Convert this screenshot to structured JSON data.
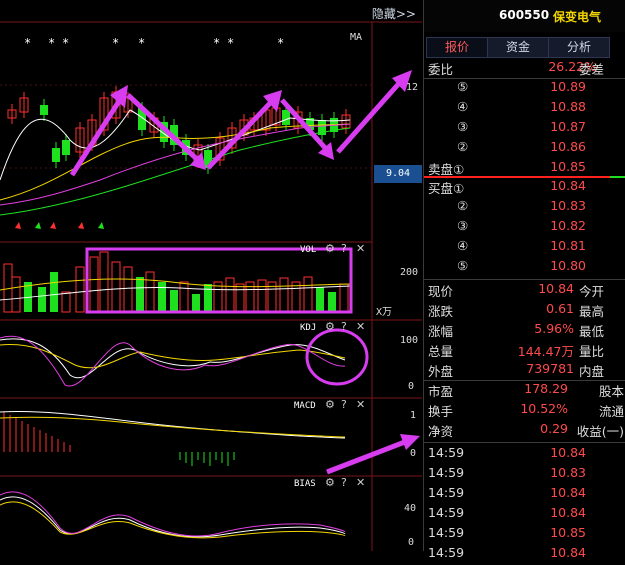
{
  "header": {
    "hide_label": "隐藏>>",
    "ma_label": "MA"
  },
  "main_chart": {
    "stars": [
      "*",
      "*",
      "*",
      "*",
      "*",
      "*",
      "*",
      "*"
    ],
    "price_labels": [
      "12",
      "9.04"
    ],
    "current_price_box": "9.04"
  },
  "vol_panel": {
    "title": "VOL",
    "scale_top": "200",
    "unit": "X万"
  },
  "kdj_panel": {
    "title": "KDJ",
    "scale_top": "100",
    "scale_bottom": "0"
  },
  "macd_panel": {
    "title": "MACD",
    "scale_top": "1",
    "scale_bottom": "0"
  },
  "bias_panel": {
    "title": "BIAS",
    "scale_mid": "40",
    "scale_bottom": "0"
  },
  "panel_tools": {
    "gear": "⚙",
    "help": "?",
    "close": "✕"
  },
  "stock": {
    "code": "600550",
    "name": "保变电气"
  },
  "tabs": [
    "报价",
    "资金",
    "分析"
  ],
  "order_book": {
    "weibi_label": "委比",
    "weibi_value": "26.22%",
    "weicha_label": "委差",
    "sells": [
      {
        "label": "⑤",
        "price": "10.89"
      },
      {
        "label": "④",
        "price": "10.88"
      },
      {
        "label": "③",
        "price": "10.87"
      },
      {
        "label": "②",
        "price": "10.86"
      },
      {
        "label": "卖盘①",
        "price": "10.85"
      }
    ],
    "buys": [
      {
        "label": "买盘①",
        "price": "10.84"
      },
      {
        "label": "②",
        "price": "10.83"
      },
      {
        "label": "③",
        "price": "10.82"
      },
      {
        "label": "④",
        "price": "10.81"
      },
      {
        "label": "⑤",
        "price": "10.80"
      }
    ]
  },
  "quote": [
    {
      "k": "现价",
      "v": "10.84",
      "k2": "今开",
      "color": "red"
    },
    {
      "k": "涨跌",
      "v": "0.61",
      "k2": "最高",
      "color": "red"
    },
    {
      "k": "涨幅",
      "v": "5.96%",
      "k2": "最低",
      "color": "red"
    },
    {
      "k": "总量",
      "v": "144.47万",
      "k2": "量比",
      "color": "yel"
    },
    {
      "k": "外盘",
      "v": "739781",
      "k2": "内盘",
      "color": "red"
    }
  ],
  "fundamentals": [
    {
      "k": "市盈",
      "v": "178.29",
      "k2": "股本"
    },
    {
      "k": "换手",
      "v": "10.52%",
      "k2": "流通"
    },
    {
      "k": "净资",
      "v": "0.29",
      "k2": "收益(一)"
    }
  ],
  "ticks": [
    {
      "time": "14:59",
      "price": "10.84"
    },
    {
      "time": "14:59",
      "price": "10.83"
    },
    {
      "time": "14:59",
      "price": "10.84"
    },
    {
      "time": "14:59",
      "price": "10.84"
    },
    {
      "time": "14:59",
      "price": "10.85"
    },
    {
      "time": "14:59",
      "price": "10.84"
    }
  ]
}
